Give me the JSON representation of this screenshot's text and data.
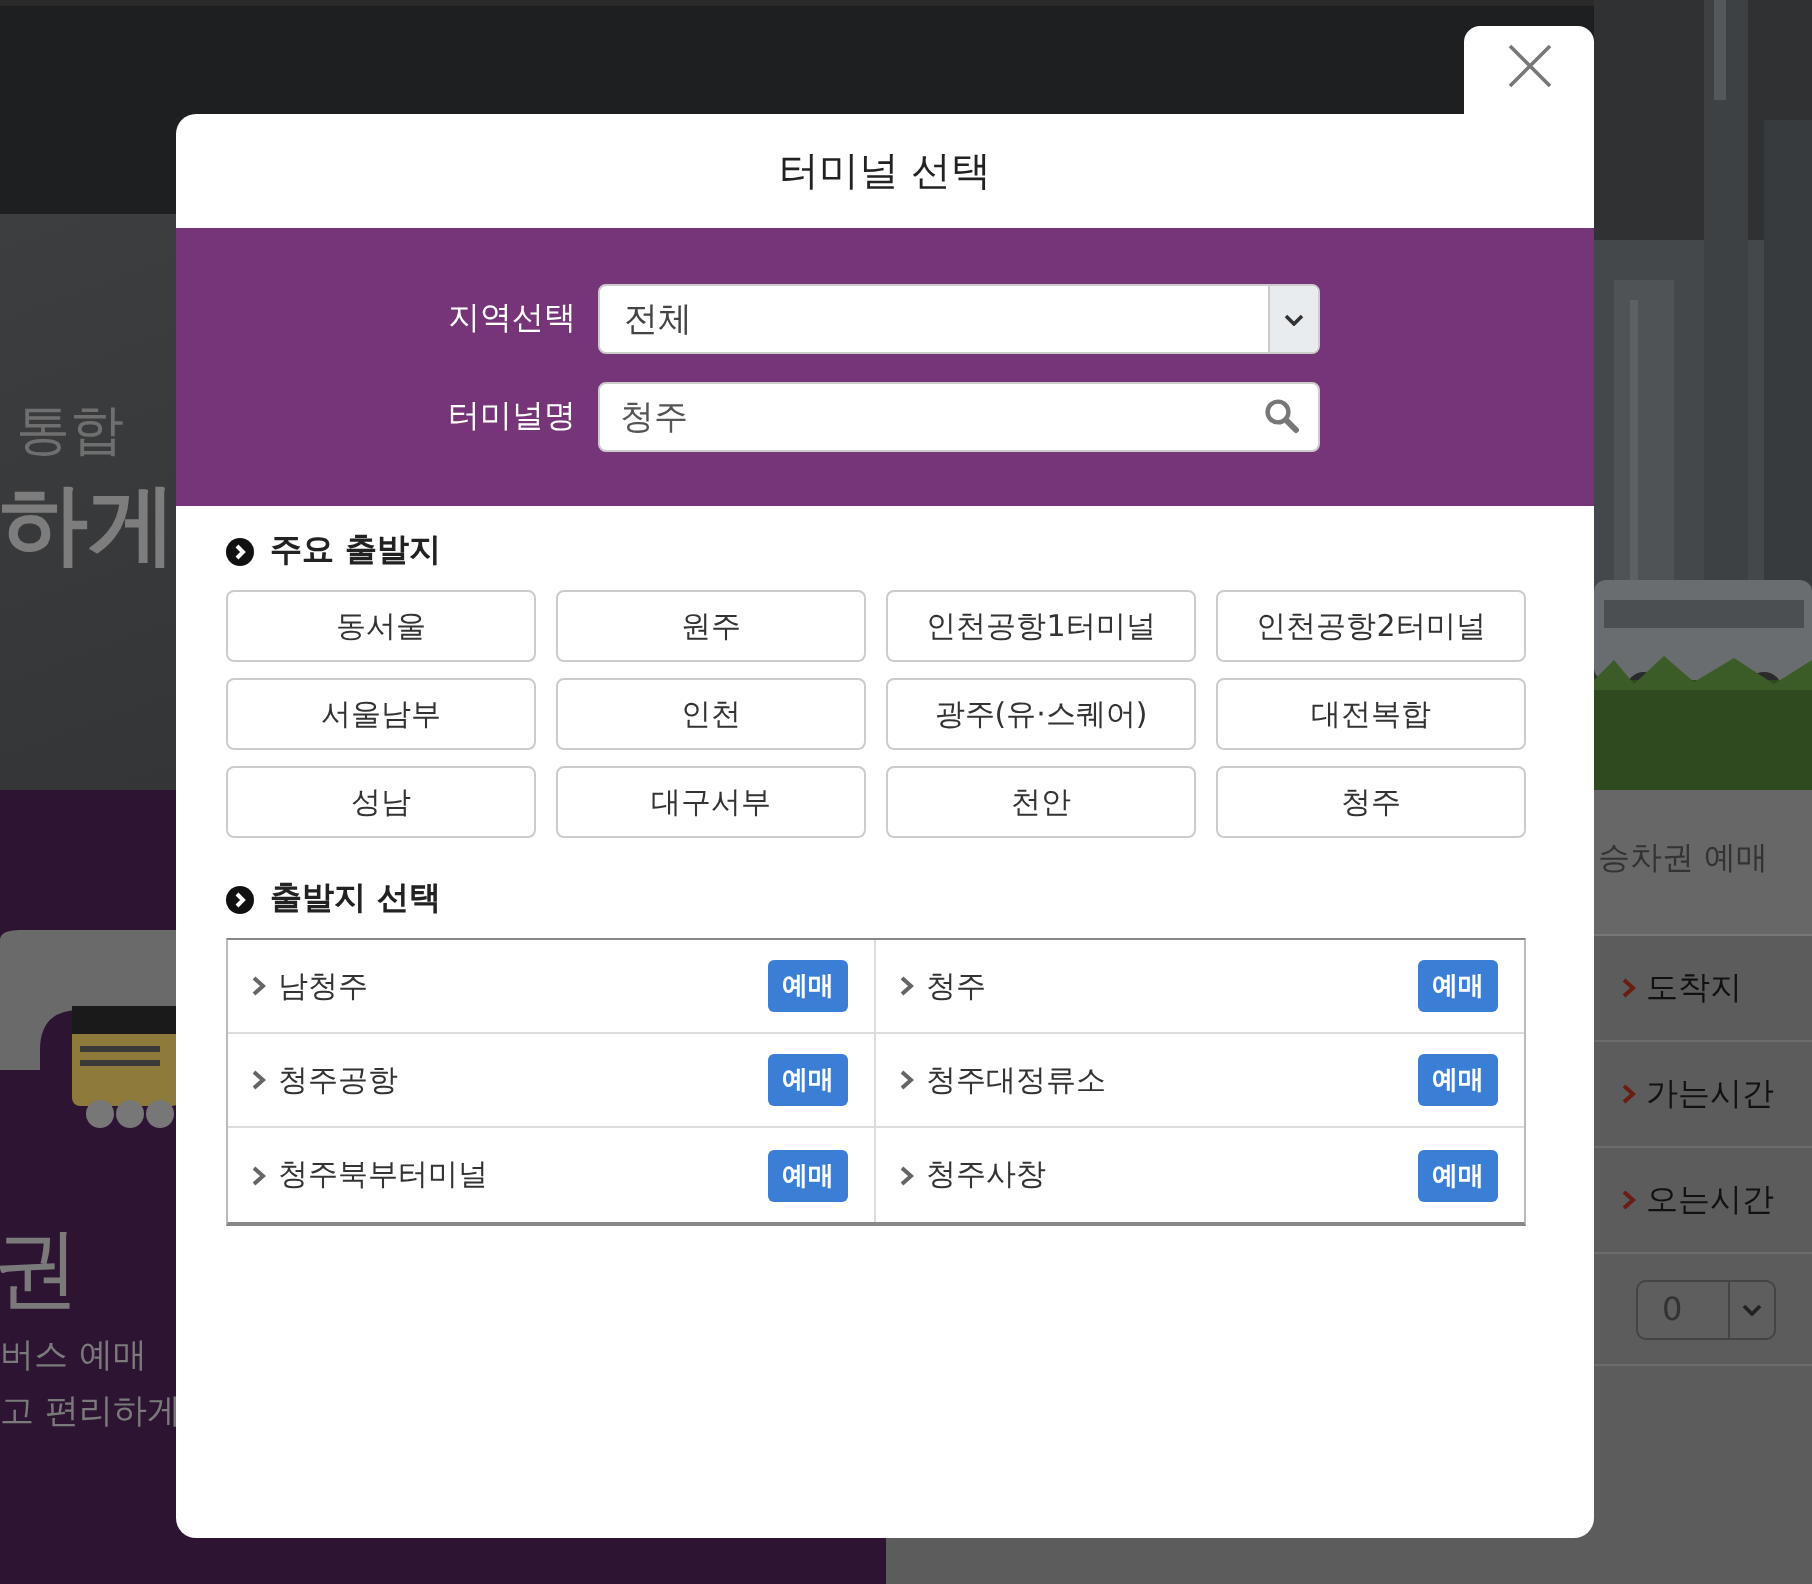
{
  "background_page": {
    "banner": {
      "line_1": "통합",
      "line_2": "하게"
    },
    "promo": {
      "title": "권",
      "lines": [
        "버스 예매",
        "고 편리하게"
      ]
    },
    "booking_panel": {
      "title": "승차권 예매",
      "fields": [
        "도착지",
        "가는시간",
        "오는시간"
      ],
      "count_select": "0"
    }
  },
  "modal": {
    "title": "터미널 선택",
    "region": {
      "label": "지역선택",
      "value": "전체"
    },
    "terminal_name": {
      "label": "터미널명",
      "value": "청주"
    },
    "major_departures": {
      "heading": "주요 출발지",
      "terminals": [
        "동서울",
        "원주",
        "인천공항1터미널",
        "인천공항2터미널",
        "서울남부",
        "인천",
        "광주(유·스퀘어)",
        "대전복합",
        "성남",
        "대구서부",
        "천안",
        "청주"
      ]
    },
    "departure_select": {
      "heading": "출발지 선택",
      "results": [
        {
          "name": "남청주",
          "button": "예매"
        },
        {
          "name": "청주",
          "button": "예매"
        },
        {
          "name": "청주공항",
          "button": "예매"
        },
        {
          "name": "청주대정류소",
          "button": "예매"
        },
        {
          "name": "청주북부터미널",
          "button": "예매"
        },
        {
          "name": "청주사창",
          "button": "예매"
        }
      ]
    }
  }
}
